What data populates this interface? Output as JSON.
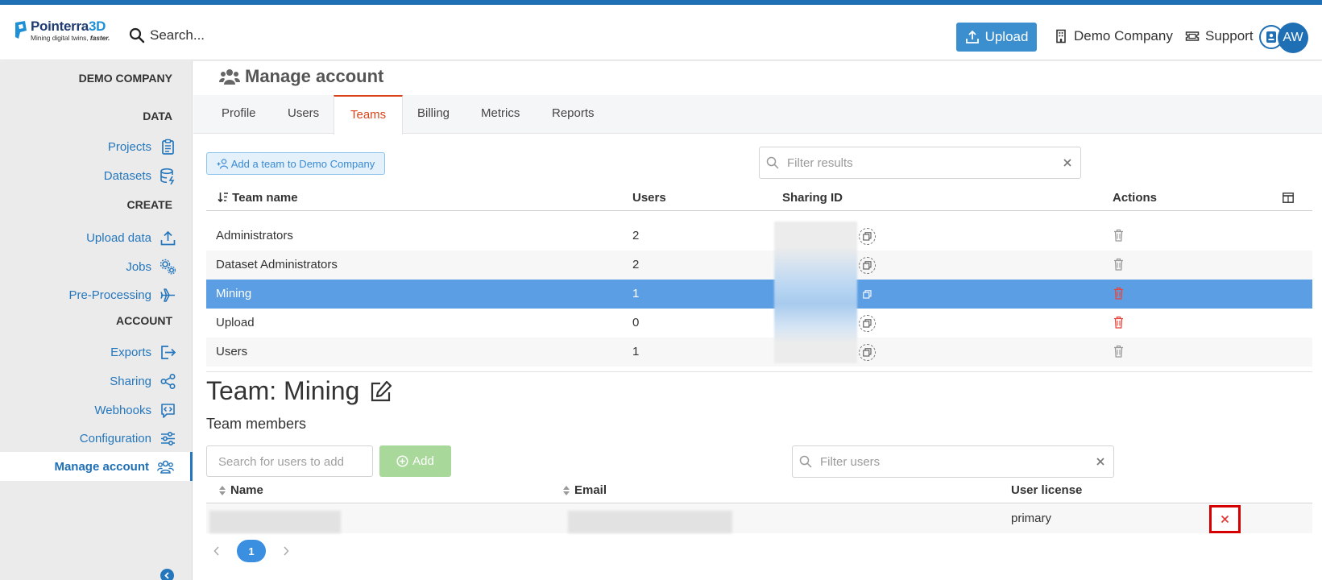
{
  "brand": {
    "name_main": "Pointerra",
    "name_accent": "3D",
    "tagline": "Mining digital twins,",
    "tagline_bold": "faster."
  },
  "topbar": {
    "search_placeholder": "Search...",
    "upload_label": "Upload",
    "company_label": "Demo Company",
    "support_label": "Support",
    "avatar_initials": "AW",
    "accent_color": "#1f6fb5"
  },
  "sidebar": {
    "company": "DEMO COMPANY",
    "section_data": "DATA",
    "section_create": "CREATE",
    "section_account": "ACCOUNT",
    "items": [
      {
        "label": "Projects",
        "icon": "clipboard-icon"
      },
      {
        "label": "Datasets",
        "icon": "database-icon"
      },
      {
        "label": "Upload data",
        "icon": "upload-icon"
      },
      {
        "label": "Jobs",
        "icon": "gears-icon"
      },
      {
        "label": "Pre-Processing",
        "icon": "plane-icon"
      },
      {
        "label": "Exports",
        "icon": "export-icon"
      },
      {
        "label": "Sharing",
        "icon": "share-icon"
      },
      {
        "label": "Webhooks",
        "icon": "webhook-icon"
      },
      {
        "label": "Configuration",
        "icon": "sliders-icon"
      },
      {
        "label": "Manage account",
        "icon": "users-icon",
        "active": true
      }
    ]
  },
  "page": {
    "title": "Manage account",
    "tabs": [
      "Profile",
      "Users",
      "Teams",
      "Billing",
      "Metrics",
      "Reports"
    ],
    "active_tab": "Teams"
  },
  "teams": {
    "add_button": "Add a team to Demo Company",
    "filter_placeholder": "Filter results",
    "columns": [
      "Team name",
      "Users",
      "Sharing ID",
      "Actions"
    ],
    "rows": [
      {
        "name": "Administrators",
        "users": "2"
      },
      {
        "name": "Dataset Administrators",
        "users": "2"
      },
      {
        "name": "Mining",
        "users": "1",
        "selected": true
      },
      {
        "name": "Upload",
        "users": "0"
      },
      {
        "name": "Users",
        "users": "1"
      }
    ]
  },
  "team_detail": {
    "title": "Team: Mining",
    "members_heading": "Team members",
    "search_placeholder": "Search for users to add",
    "add_label": "Add",
    "filter_placeholder": "Filter users",
    "columns": [
      "Name",
      "Email",
      "User license"
    ],
    "members": [
      {
        "license": "primary"
      }
    ],
    "current_page": "1"
  }
}
